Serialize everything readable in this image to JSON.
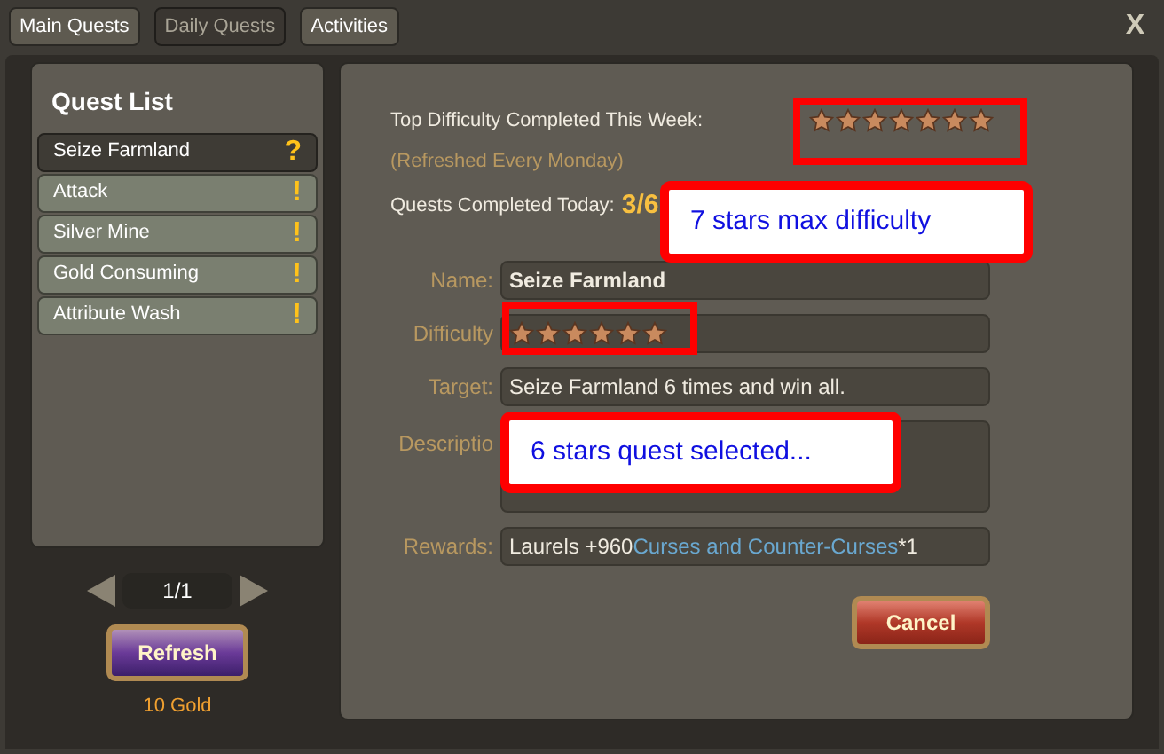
{
  "tabs": [
    {
      "label": "Main Quests",
      "selected": false
    },
    {
      "label": "Daily Quests",
      "selected": true
    },
    {
      "label": "Activities",
      "selected": false
    }
  ],
  "close": "X",
  "quest_list": {
    "title": "Quest List",
    "items": [
      {
        "name": "Seize Farmland",
        "marker": "?",
        "selected": true
      },
      {
        "name": "Attack",
        "marker": "!",
        "selected": false
      },
      {
        "name": "Silver Mine",
        "marker": "!",
        "selected": false
      },
      {
        "name": "Gold Consuming",
        "marker": "!",
        "selected": false
      },
      {
        "name": "Attribute Wash",
        "marker": "!",
        "selected": false
      }
    ],
    "page": "1/1",
    "refresh": "Refresh",
    "cost": "10 Gold"
  },
  "summary": {
    "top_label": "Top Difficulty Completed This Week:",
    "top_difficulty": {
      "stars": 7
    },
    "note": "(Refreshed Every Monday)",
    "today_label": "Quests Completed Today:",
    "today_value": "3/6"
  },
  "details": {
    "name_label": "Name:",
    "name": "Seize Farmland",
    "difficulty_label": "Difficulty",
    "difficulty": {
      "stars": 6
    },
    "target_label": "Target:",
    "target": "Seize Farmland 6 times and win all.",
    "description_label": "Descriptio",
    "rewards_label": "Rewards:",
    "rewards_prefix": "Laurels +960",
    "rewards_item": "Curses and Counter-Curses",
    "rewards_suffix": "*1"
  },
  "cancel": "Cancel",
  "annotations": [
    "7 stars max difficulty",
    "6 stars quest selected..."
  ]
}
